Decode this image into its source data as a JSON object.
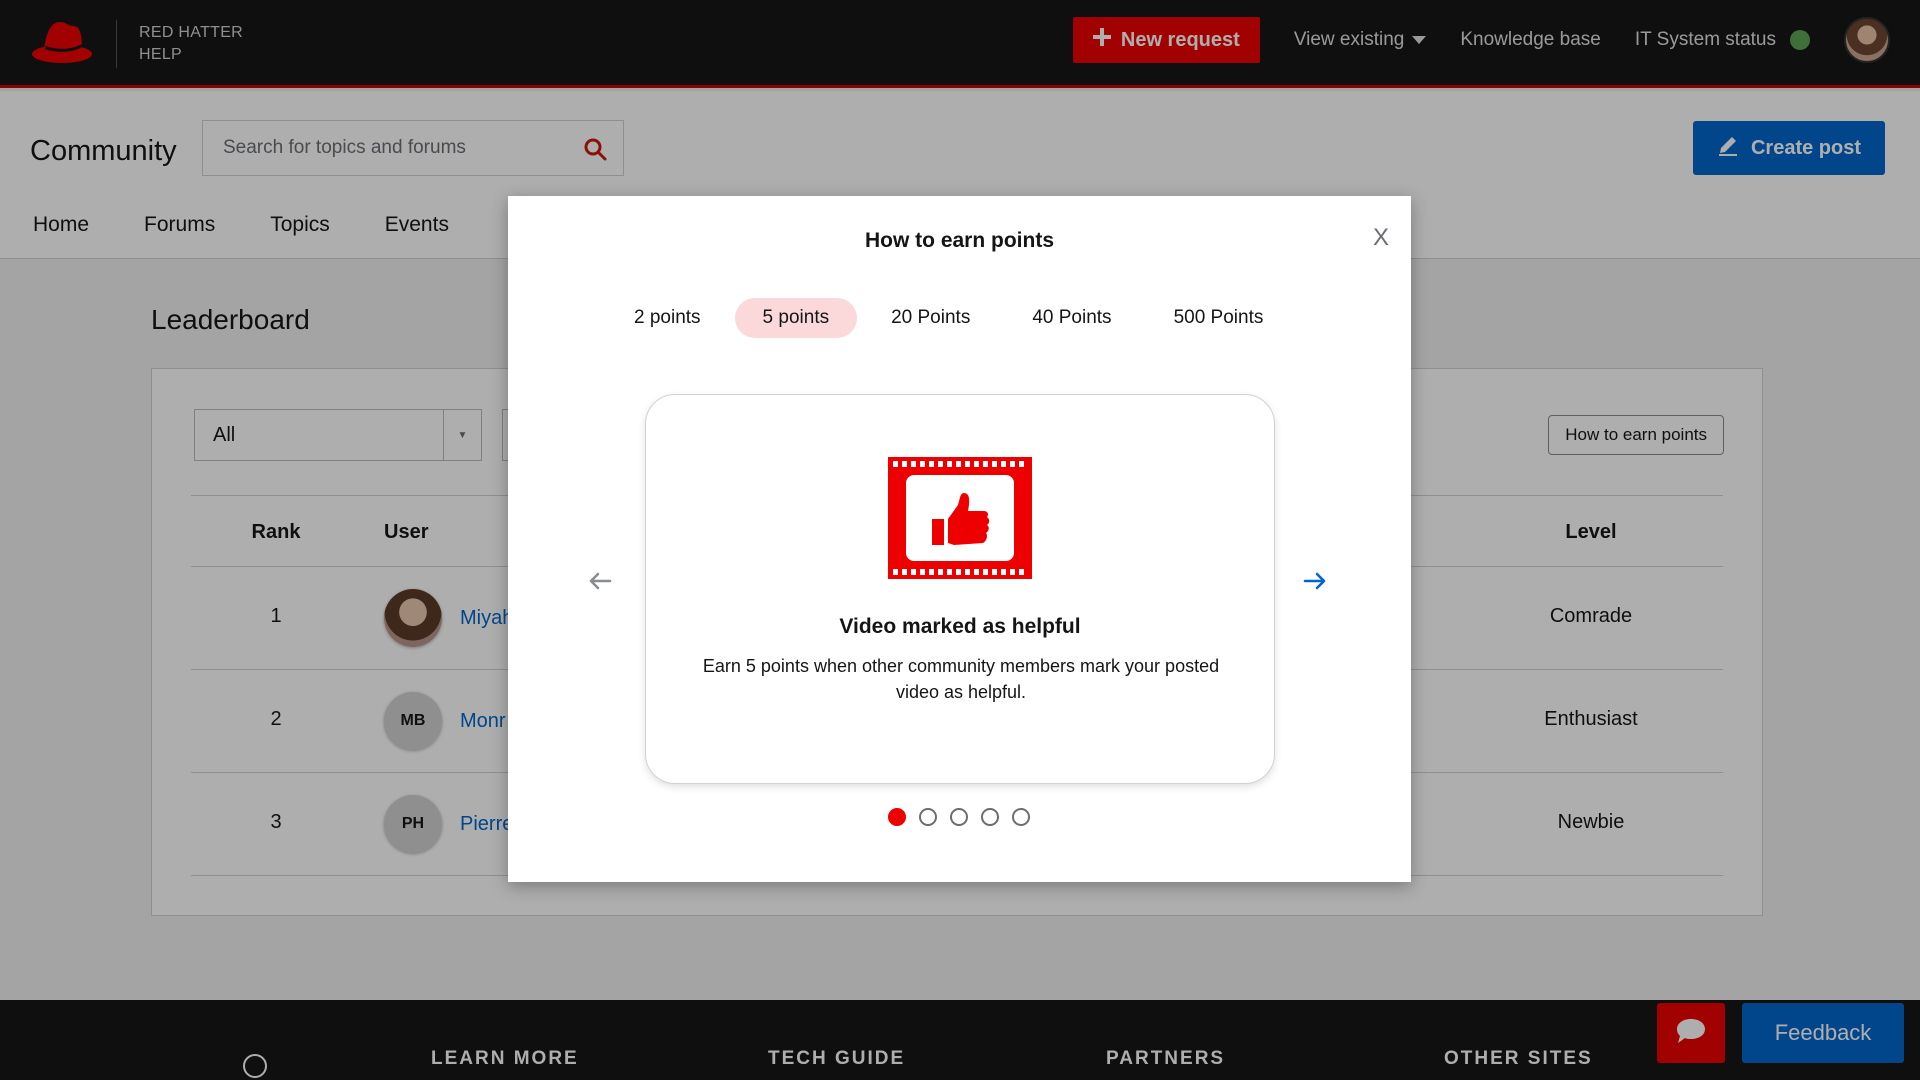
{
  "topbar": {
    "brand_line1": "RED HATTER",
    "brand_line2": "HELP",
    "new_request": "New request",
    "view_existing": "View existing",
    "knowledge_base": "Knowledge base",
    "it_status": "IT System status",
    "status_color": "#5ba352"
  },
  "community": {
    "title": "Community",
    "search_placeholder": "Search for topics and forums",
    "create_post": "Create post",
    "tabs": [
      "Home",
      "Forums",
      "Topics",
      "Events"
    ]
  },
  "leaderboard": {
    "title": "Leaderboard",
    "filter_value": "All",
    "how_to_button": "How to earn points",
    "headers": {
      "rank": "Rank",
      "user": "User",
      "level": "Level"
    },
    "rows": [
      {
        "rank": "1",
        "initials": "",
        "name": "Miyah",
        "level": "Comrade"
      },
      {
        "rank": "2",
        "initials": "MB",
        "name": "Monr",
        "level": "Enthusiast"
      },
      {
        "rank": "3",
        "initials": "PH",
        "name": "Pierre",
        "level": "Newbie"
      }
    ]
  },
  "modal": {
    "title": "How to earn points",
    "close": "X",
    "tabs": [
      "2 points",
      "5 points",
      "20 Points",
      "40 Points",
      "500 Points"
    ],
    "active_tab": 1,
    "slide": {
      "icon": "film-thumbs-up-icon",
      "heading": "Video marked as helpful",
      "text": "Earn 5 points when other community members mark your posted video as helpful."
    },
    "dots": 5,
    "active_dot": 0
  },
  "footer": {
    "links": [
      "LEARN MORE",
      "TECH GUIDE",
      "PARTNERS",
      "OTHER SITES"
    ],
    "feedback": "Feedback"
  },
  "colors": {
    "brand_red": "#ee0000",
    "primary_blue": "#0066cc",
    "active_tab_bg": "#fbd9db"
  }
}
